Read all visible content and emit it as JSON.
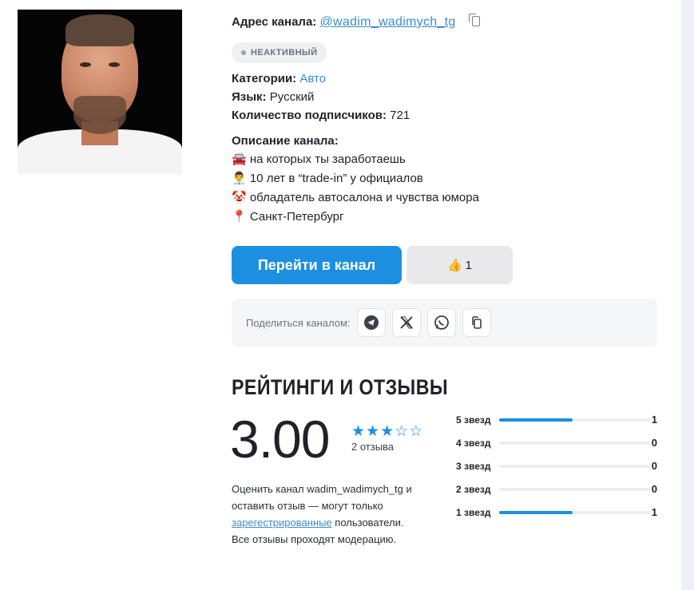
{
  "channel": {
    "address_label": "Адрес канала:",
    "address_value": "@wadim_wadimych_tg",
    "status": "НЕАКТИВНЫЙ",
    "category_label": "Категории:",
    "category_value": "Авто",
    "language_label": "Язык:",
    "language_value": "Русский",
    "subscribers_label": "Количество подписчиков:",
    "subscribers_value": "721"
  },
  "description": {
    "title": "Описание канала:",
    "lines": [
      "🚘 на которых ты заработаешь",
      "👨‍💼 10 лет в “trade-in” у официалов",
      "🤡 обладатель автосалона и чувства юмора",
      "📍 Санкт-Петербург"
    ]
  },
  "actions": {
    "go_label": "Перейти в канал",
    "like_icon": "👍",
    "like_count": "1"
  },
  "share": {
    "label": "Поделиться каналом:",
    "buttons": [
      "telegram-icon",
      "x-icon",
      "whatsapp-icon",
      "copy-icon"
    ]
  },
  "ratings": {
    "title": "РЕЙТИНГИ И ОТЗЫВЫ",
    "score": "3.00",
    "stars_filled": 3,
    "stars_total": 5,
    "reviews_count": "2 отзыва",
    "note_before": "Оценить канал wadim_wadimych_tg и оставить отзыв — могут только ",
    "note_link": "зарегестрированные",
    "note_after": " пользователи. Все отзывы проходят модерацию.",
    "distribution": [
      {
        "label": "5 звезд",
        "count": "1",
        "fraction": 0.5
      },
      {
        "label": "4 звезд",
        "count": "0",
        "fraction": 0
      },
      {
        "label": "3 звезд",
        "count": "0",
        "fraction": 0
      },
      {
        "label": "2 звезд",
        "count": "0",
        "fraction": 0
      },
      {
        "label": "1 звезд",
        "count": "1",
        "fraction": 0.5
      }
    ]
  },
  "colors": {
    "accent": "#1d8fe0",
    "link": "#3b8bd0"
  }
}
